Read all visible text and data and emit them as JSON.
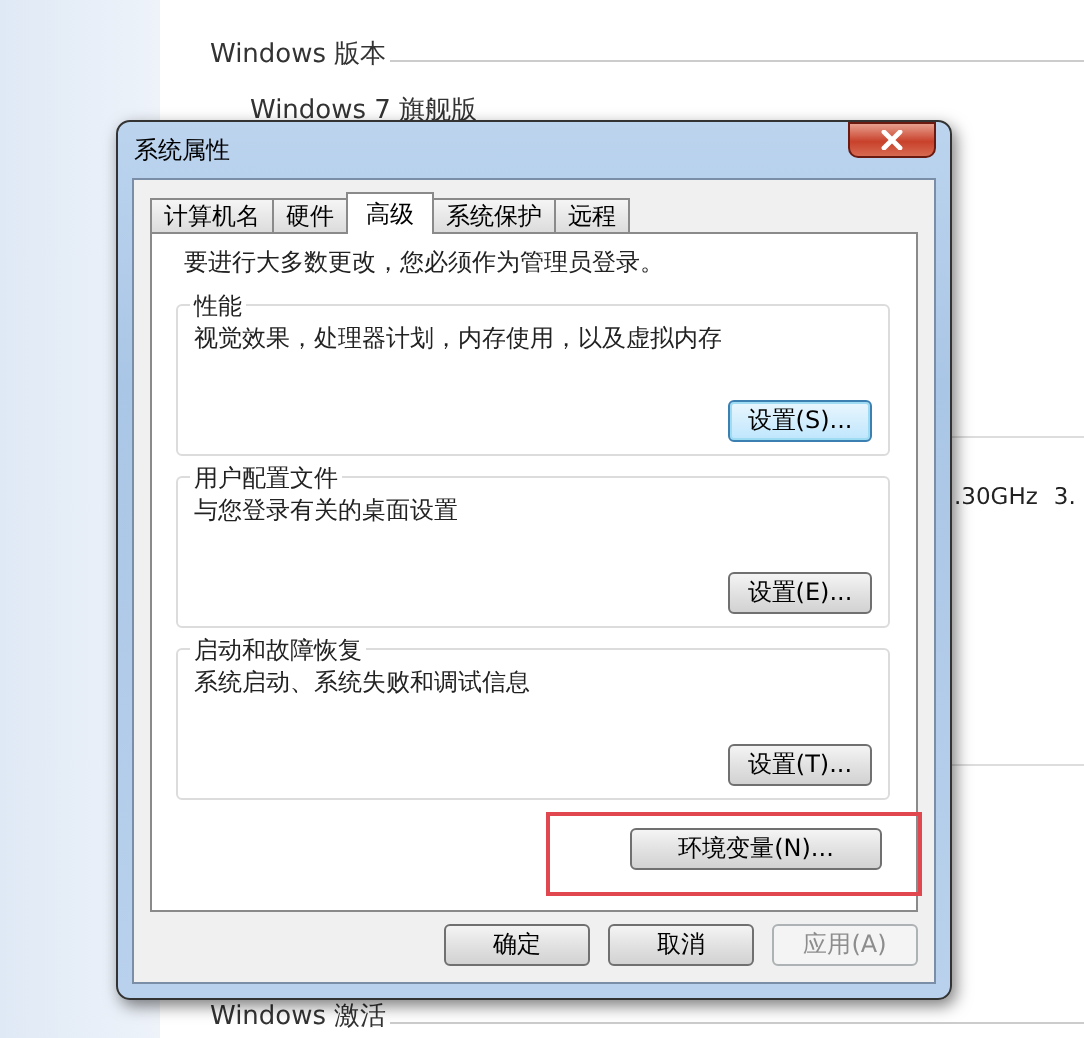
{
  "background": {
    "section_title": "Windows 版本",
    "edition": "Windows 7 旗舰版",
    "cpu_speed": ".30GHz",
    "column_2": "3.",
    "footer_section": "Windows 激活"
  },
  "dialog": {
    "title": "系统属性",
    "tabs": [
      {
        "label": "计算机名",
        "selected": false
      },
      {
        "label": "硬件",
        "selected": false
      },
      {
        "label": "高级",
        "selected": true
      },
      {
        "label": "系统保护",
        "selected": false
      },
      {
        "label": "远程",
        "selected": false
      }
    ],
    "notice": "要进行大多数更改，您必须作为管理员登录。",
    "groups": [
      {
        "title": "性能",
        "description": "视觉效果，处理器计划，内存使用，以及虚拟内存",
        "button": "设置(S)...",
        "focused": true
      },
      {
        "title": "用户配置文件",
        "description": "与您登录有关的桌面设置",
        "button": "设置(E)...",
        "focused": false
      },
      {
        "title": "启动和故障恢复",
        "description": "系统启动、系统失败和调试信息",
        "button": "设置(T)...",
        "focused": false
      }
    ],
    "env_button": {
      "label": "环境变量(N)...",
      "highlighted": true
    },
    "buttons": [
      {
        "label": "确定",
        "disabled": false
      },
      {
        "label": "取消",
        "disabled": false
      },
      {
        "label": "应用(A)",
        "disabled": true
      }
    ]
  }
}
